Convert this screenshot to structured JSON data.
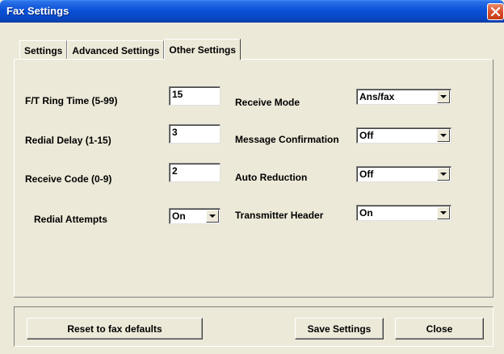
{
  "window": {
    "title": "Fax Settings",
    "close_icon": "close-x-icon"
  },
  "tabs": [
    {
      "label": "Settings",
      "active": false
    },
    {
      "label": "Advanced Settings",
      "active": false
    },
    {
      "label": "Other Settings",
      "active": true
    }
  ],
  "fields": {
    "ft_ring_time": {
      "label": "F/T Ring Time (5-99)",
      "value": "15"
    },
    "redial_delay": {
      "label": "Redial Delay (1-15)",
      "value": "3"
    },
    "receive_code": {
      "label": "Receive Code (0-9)",
      "value": "2"
    },
    "redial_attempts": {
      "label": "Redial Attempts",
      "value": "On"
    },
    "receive_mode": {
      "label": "Receive Mode",
      "value": "Ans/fax"
    },
    "message_confirmation": {
      "label": "Message Confirmation",
      "value": "Off"
    },
    "auto_reduction": {
      "label": "Auto Reduction",
      "value": "Off"
    },
    "transmitter_header": {
      "label": "Transmitter Header",
      "value": "On"
    }
  },
  "buttons": {
    "reset": "Reset to fax defaults",
    "save": "Save Settings",
    "close": "Close"
  },
  "colors": {
    "titlebar": "#0a52d9",
    "window_bg": "#ece9d8",
    "close_button": "#d9502c"
  }
}
